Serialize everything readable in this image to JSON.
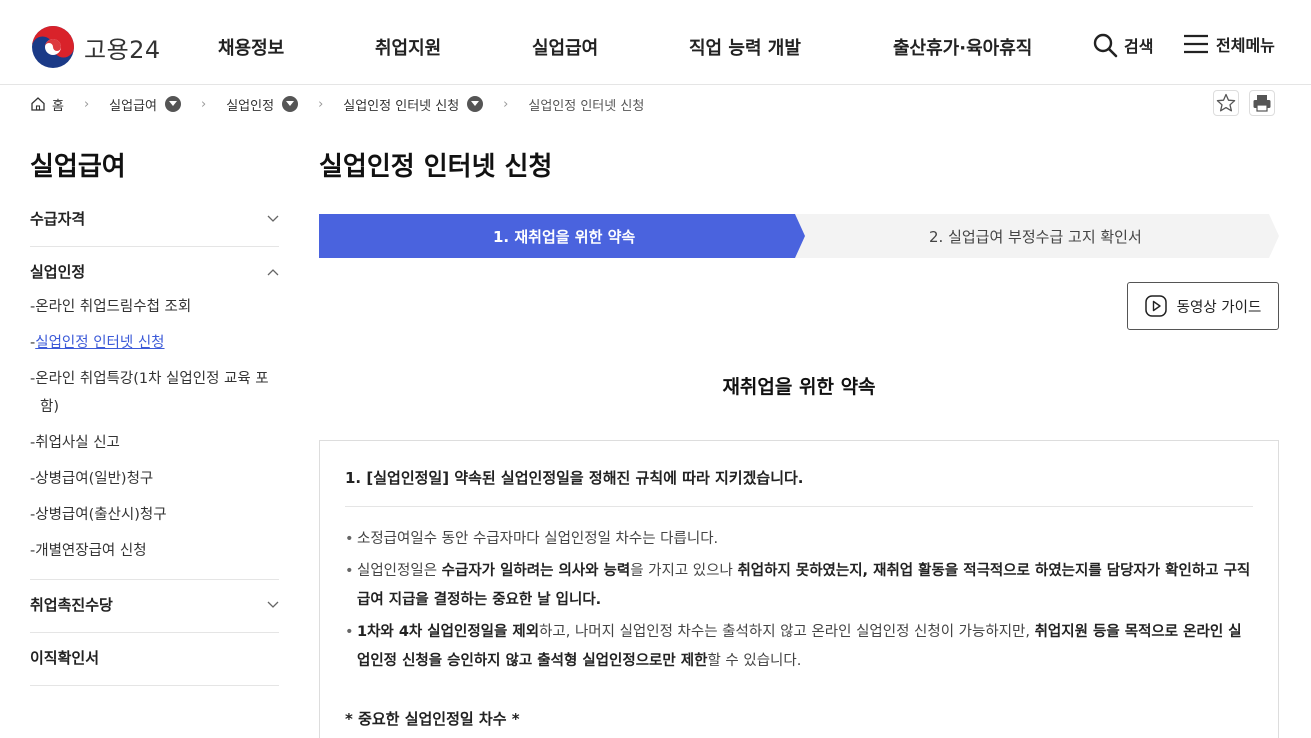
{
  "header": {
    "logo_text": "고용24",
    "nav": [
      "채용정보",
      "취업지원",
      "실업급여",
      "직업 능력 개발",
      "출산휴가·육아휴직"
    ],
    "search_label": "검색",
    "menu_label": "전체메뉴"
  },
  "breadcrumb": {
    "home": "홈",
    "items": [
      "실업급여",
      "실업인정",
      "실업인정 인터넷 신청"
    ],
    "current": "실업인정 인터넷 신청"
  },
  "sidebar": {
    "title": "실업급여",
    "groups": [
      {
        "label": "수급자격"
      },
      {
        "label": "실업인정",
        "items": [
          "온라인 취업드림수첩 조회",
          "실업인정 인터넷 신청",
          "온라인 취업특강(1차 실업인정 교육 포함)",
          "취업사실 신고",
          "상병급여(일반)청구",
          "상병급여(출산시)청구",
          "개별연장급여 신청"
        ]
      },
      {
        "label": "취업촉진수당"
      },
      {
        "label": "이직확인서"
      }
    ]
  },
  "main": {
    "title": "실업인정 인터넷 신청",
    "steps": [
      "1. 재취업을 위한 약속",
      "2. 실업급여 부정수급 고지 확인서"
    ],
    "active_step": 1,
    "video_button": "동영상 가이드",
    "section_heading": "재취업을 위한 약속",
    "box_title": "1. [실업인정일] 약속된 실업인정일을 정해진 규칙에 따라 지키겠습니다.",
    "bullets": [
      {
        "parts": [
          {
            "t": "소정급여일수 동안 수급자마다 실업인정일 차수는 다릅니다.",
            "b": false
          }
        ]
      },
      {
        "parts": [
          {
            "t": "실업인정일은 ",
            "b": false
          },
          {
            "t": "수급자가 일하려는 의사와 능력",
            "b": true
          },
          {
            "t": "을 가지고 있으나 ",
            "b": false
          },
          {
            "t": "취업하지 못하였는지, 재취업 활동을 적극적으로 하였는지를 담당자가 확인하고 구직급여 지급을 결정하는 중요한 날 입니다.",
            "b": true
          }
        ]
      },
      {
        "parts": [
          {
            "t": "1차와 4차 실업인정일을 제외",
            "b": true
          },
          {
            "t": "하고, 나머지 실업인정 차수는 출석하지 않고 온라인 실업인정 신청이 가능하지만, ",
            "b": false
          },
          {
            "t": "취업지원 등을 목적으로 온라인 실업인정 신청을 승인하지 않고 출석형 실업인정으로만 제한",
            "b": true
          },
          {
            "t": "할 수 있습니다.",
            "b": false
          }
        ]
      }
    ],
    "important_heading": "* 중요한 실업인정일 차수 *"
  },
  "colors": {
    "active_step": "#4a63de",
    "inactive_step": "#f3f3f3",
    "link_active": "#3d5bd8"
  }
}
